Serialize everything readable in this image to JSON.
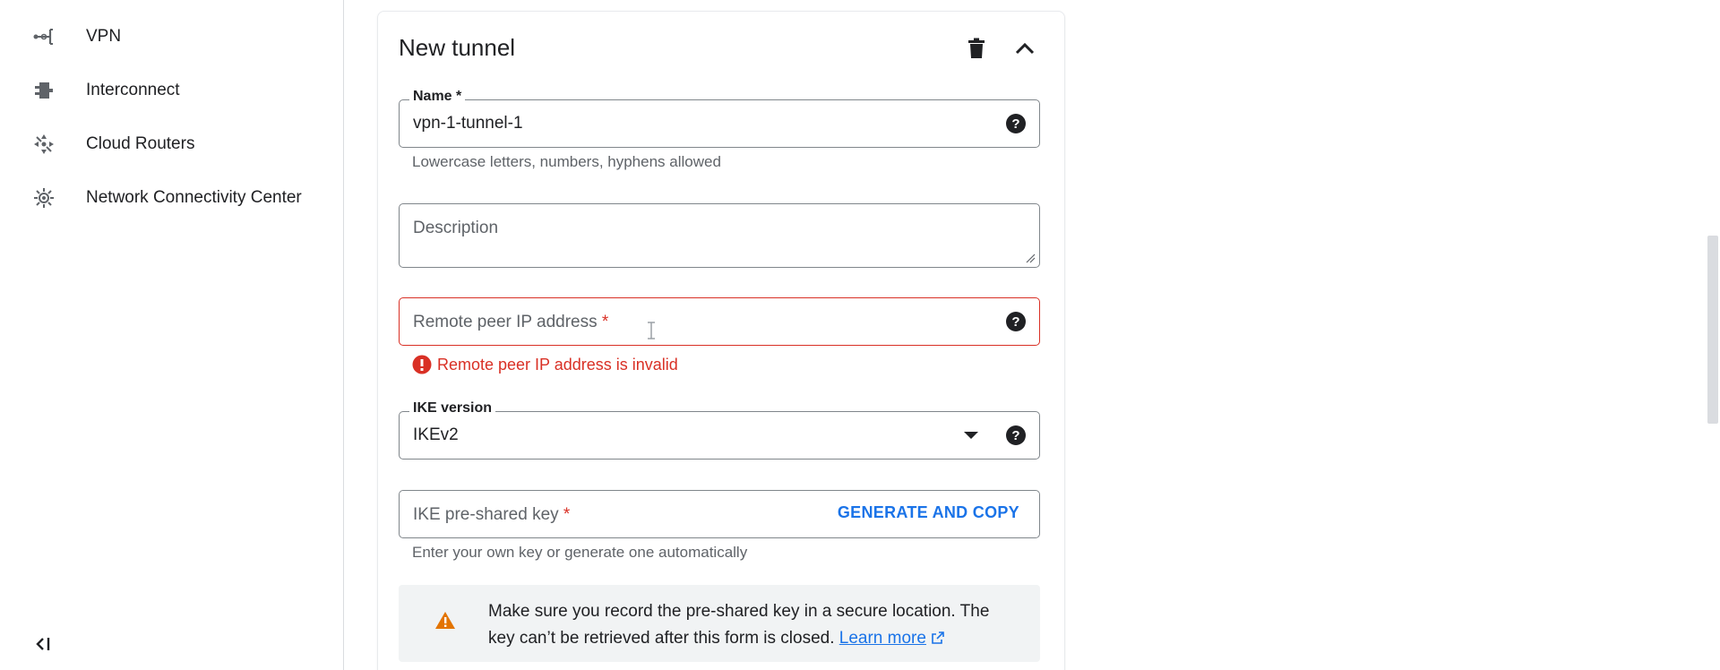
{
  "sidebar": {
    "items": [
      {
        "label": "VPN",
        "icon": "vpn-icon"
      },
      {
        "label": "Interconnect",
        "icon": "interconnect-icon"
      },
      {
        "label": "Cloud Routers",
        "icon": "cloud-routers-icon"
      },
      {
        "label": "Network Connectivity Center",
        "icon": "network-connectivity-center-icon"
      }
    ],
    "collapse_icon": "collapse-sidebar-icon"
  },
  "card": {
    "title": "New tunnel",
    "delete_icon": "trash-icon",
    "collapse_icon": "chevron-up-icon"
  },
  "form": {
    "name": {
      "label": "Name *",
      "value": "vpn-1-tunnel-1",
      "hint": "Lowercase letters, numbers, hyphens allowed"
    },
    "description": {
      "placeholder": "Description"
    },
    "remote_peer": {
      "placeholder": "Remote peer IP address",
      "required_mark": "*",
      "error": "Remote peer IP address is invalid"
    },
    "ike_version": {
      "label": "IKE version",
      "value": "IKEv2"
    },
    "psk": {
      "placeholder": "IKE pre-shared key",
      "required_mark": "*",
      "button": "GENERATE AND COPY",
      "hint": "Enter your own key or generate one automatically"
    },
    "warning": {
      "text": "Make sure you record the pre-shared key in a secure location. The key can’t be retrieved after this form is closed.",
      "link": "Learn more"
    }
  },
  "colors": {
    "accent": "#1a73e8",
    "error": "#d93025",
    "warning": "#e37400",
    "border": "#80868b"
  }
}
